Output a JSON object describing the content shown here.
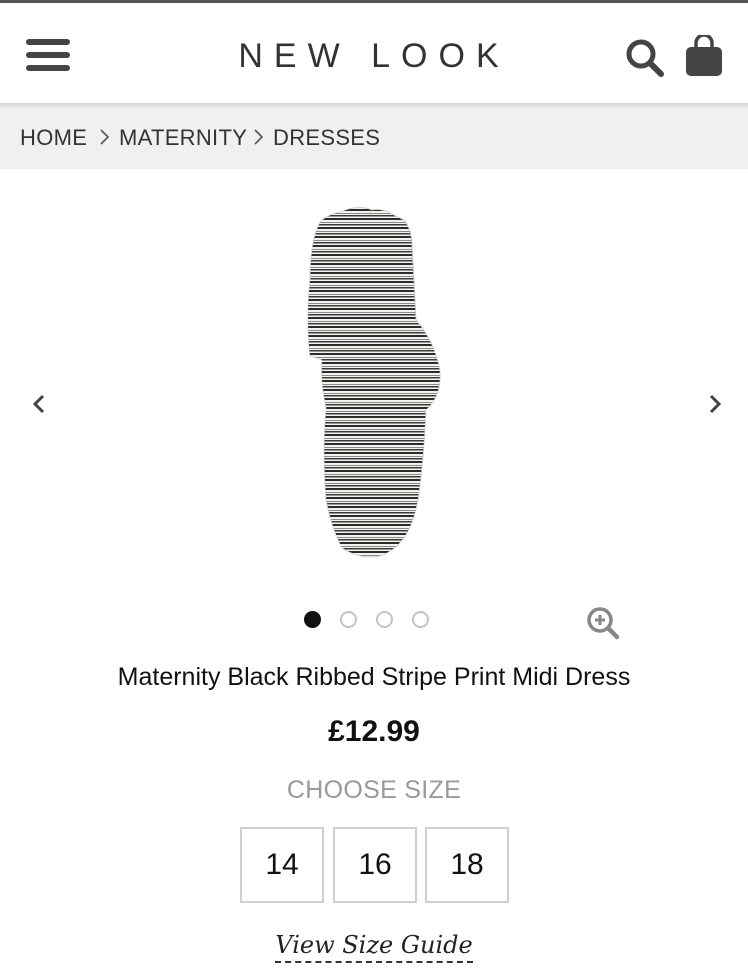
{
  "header": {
    "brand": "NEW LOOK",
    "menu_icon": "hamburger-menu-icon",
    "search_icon": "search-icon",
    "bag_icon": "shopping-bag-icon"
  },
  "breadcrumb": {
    "items": [
      "HOME",
      "MATERNITY",
      "DRESSES"
    ],
    "separator_icon": "chevron-right-icon"
  },
  "gallery": {
    "image_description": "striped maternity midi dress",
    "prev_icon": "chevron-left-icon",
    "next_icon": "chevron-right-icon",
    "dot_count": 4,
    "active_dot": 1,
    "zoom_icon": "zoom-in-icon"
  },
  "product": {
    "title": "Maternity Black Ribbed Stripe Print Midi Dress",
    "price": "£12.99",
    "choose_size_label": "CHOOSE SIZE",
    "sizes": [
      "14",
      "16",
      "18"
    ],
    "size_guide_label": "View Size Guide"
  },
  "colors": {
    "header_icon": "#444444",
    "breadcrumb_bg": "#f0f0f0",
    "active_dot": "#111111",
    "inactive_dot_border": "#c4c4c4",
    "muted_text": "#999999"
  }
}
